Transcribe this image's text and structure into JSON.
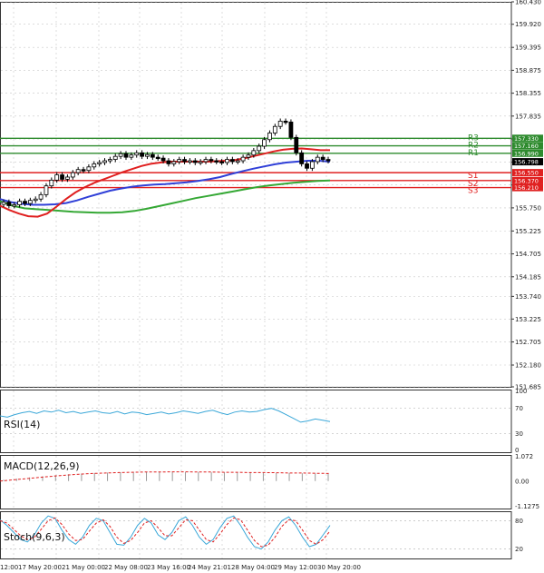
{
  "chart_data": [
    {
      "type": "candlestick",
      "price_axis_ticks": [
        "160.430",
        "159.920",
        "159.395",
        "158.875",
        "158.355",
        "157.835",
        "157.315",
        "156.790",
        "156.270",
        "155.750",
        "155.225",
        "154.705",
        "154.185",
        "153.740",
        "153.225",
        "152.705",
        "152.180",
        "151.685"
      ],
      "time_labels": [
        "12:00",
        "17 May 20:00",
        "21 May 00:00",
        "22 May 08:00",
        "23 May 16:00",
        "24 May 21:01",
        "28 May 04:00",
        "29 May 12:00",
        "30 May 20:00"
      ],
      "pivots": [
        {
          "name": "R3",
          "value": 157.33,
          "value_label": "157.330",
          "color": "#2e8b2e"
        },
        {
          "name": "R2",
          "value": 157.16,
          "value_label": "157.160",
          "color": "#2e8b2e"
        },
        {
          "name": "R1",
          "value": 156.99,
          "value_label": "156.990",
          "color": "#2e8b2e"
        },
        {
          "name": "S1",
          "value": 156.55,
          "value_label": "156.550",
          "color": "#e02020"
        },
        {
          "name": "S2",
          "value": 156.37,
          "value_label": "156.370",
          "color": "#e02020"
        },
        {
          "name": "S3",
          "value": 156.21,
          "value_label": "156.210",
          "color": "#e02020"
        }
      ],
      "current_price": {
        "value": 156.798,
        "label": "156.798"
      },
      "candles_close": [
        155.88,
        155.8,
        155.82,
        155.9,
        155.85,
        155.92,
        155.95,
        156.05,
        156.25,
        156.38,
        156.5,
        156.4,
        156.45,
        156.55,
        156.62,
        156.6,
        156.68,
        156.75,
        156.78,
        156.82,
        156.85,
        156.92,
        156.98,
        156.9,
        156.95,
        157.0,
        156.92,
        156.96,
        156.9,
        156.88,
        156.82,
        156.75,
        156.8,
        156.85,
        156.8,
        156.82,
        156.78,
        156.8,
        156.85,
        156.82,
        156.8,
        156.78,
        156.85,
        156.8,
        156.82,
        156.9,
        156.95,
        157.05,
        157.15,
        157.3,
        157.45,
        157.6,
        157.72,
        157.7,
        157.35,
        157.0,
        156.75,
        156.65,
        156.8,
        156.9,
        156.85,
        156.82
      ],
      "ma_fast": [
        155.8,
        155.7,
        155.62,
        155.56,
        155.55,
        155.62,
        155.78,
        155.95,
        156.1,
        156.22,
        156.32,
        156.4,
        156.48,
        156.56,
        156.63,
        156.7,
        156.75,
        156.78,
        156.8,
        156.8,
        156.8,
        156.8,
        156.8,
        156.81,
        156.82,
        156.84,
        156.88,
        156.93,
        156.98,
        157.03,
        157.07,
        157.09,
        157.1,
        157.08,
        157.06,
        157.06
      ],
      "ma_mid": [
        155.95,
        155.88,
        155.84,
        155.82,
        155.82,
        155.83,
        155.86,
        155.92,
        156.0,
        156.07,
        156.14,
        156.19,
        156.23,
        156.26,
        156.28,
        156.29,
        156.31,
        156.33,
        156.36,
        156.4,
        156.45,
        156.52,
        156.58,
        156.64,
        156.69,
        156.74,
        156.78,
        156.8,
        156.82,
        156.82,
        156.8
      ],
      "ma_slow": [
        155.9,
        155.8,
        155.74,
        155.72,
        155.7,
        155.68,
        155.66,
        155.65,
        155.64,
        155.64,
        155.65,
        155.68,
        155.73,
        155.79,
        155.85,
        155.91,
        155.97,
        156.02,
        156.07,
        156.12,
        156.17,
        156.22,
        156.26,
        156.29,
        156.32,
        156.34,
        156.36,
        156.37
      ],
      "rsi": {
        "label": "RSI(14)",
        "ticks": [
          "100",
          "70",
          "30",
          "0"
        ],
        "levels": [
          70,
          30
        ],
        "values": [
          58,
          56,
          60,
          63,
          65,
          62,
          66,
          64,
          67,
          63,
          65,
          62,
          64,
          66,
          63,
          62,
          65,
          61,
          64,
          63,
          60,
          62,
          64,
          61,
          63,
          66,
          64,
          62,
          65,
          67,
          63,
          60,
          64,
          66,
          64,
          65,
          68,
          70,
          66,
          60,
          54,
          48,
          50,
          53,
          51,
          49
        ]
      },
      "macd": {
        "label": "MACD(12,26,9)",
        "ticks": [
          "1.072",
          "0.00",
          "-1.1275"
        ],
        "values": [
          0.05,
          0.1,
          0.15,
          0.2,
          0.24,
          0.28,
          0.31,
          0.33,
          0.35,
          0.36,
          0.37,
          0.37,
          0.38,
          0.38,
          0.37,
          0.37,
          0.36,
          0.36,
          0.35,
          0.35,
          0.34,
          0.33,
          0.33,
          0.32,
          0.31,
          0.3
        ],
        "signal": [
          0.0,
          0.05,
          0.1,
          0.15,
          0.2,
          0.24,
          0.28,
          0.31,
          0.33,
          0.35,
          0.36,
          0.37,
          0.37,
          0.38,
          0.38,
          0.37,
          0.37,
          0.36,
          0.36,
          0.35,
          0.35,
          0.34,
          0.33,
          0.33,
          0.32,
          0.31
        ]
      },
      "stoch": {
        "label": "Stoch(9,6,3)",
        "ticks": [
          "80",
          "20"
        ],
        "levels": [
          80,
          20
        ],
        "k": [
          82,
          70,
          55,
          40,
          35,
          50,
          75,
          90,
          85,
          60,
          40,
          30,
          45,
          70,
          85,
          80,
          55,
          30,
          28,
          45,
          70,
          85,
          75,
          50,
          40,
          55,
          80,
          88,
          70,
          45,
          30,
          40,
          65,
          85,
          90,
          70,
          45,
          25,
          20,
          35,
          60,
          80,
          88,
          70,
          45,
          25,
          30,
          50,
          70
        ],
        "d": [
          80,
          75,
          62,
          48,
          40,
          45,
          62,
          80,
          86,
          72,
          52,
          38,
          40,
          58,
          75,
          82,
          68,
          45,
          32,
          38,
          55,
          75,
          80,
          65,
          48,
          48,
          65,
          82,
          80,
          60,
          40,
          35,
          52,
          72,
          86,
          82,
          60,
          38,
          25,
          28,
          45,
          68,
          82,
          80,
          60,
          38,
          30,
          40,
          58
        ]
      }
    }
  ]
}
